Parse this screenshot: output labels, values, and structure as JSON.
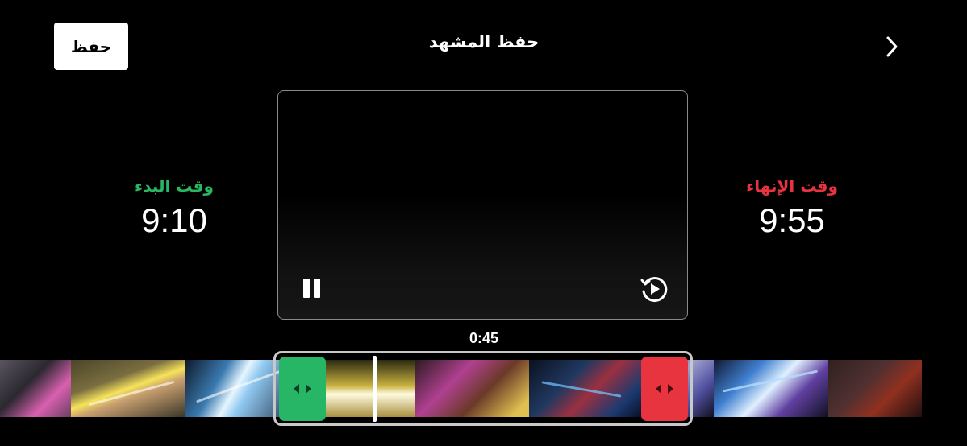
{
  "header": {
    "save_label": "حفظ",
    "title": "حفظ المشهد",
    "back_icon": "chevron-right-icon"
  },
  "trim": {
    "start_label": "وقت البدء",
    "start_time": "9:10",
    "end_label": "وقت الإنهاء",
    "end_time": "9:55",
    "duration": "0:45"
  },
  "player": {
    "pause_icon": "pause-icon",
    "replay_icon": "replay-icon",
    "state": "playing"
  },
  "colors": {
    "start_accent": "#27b566",
    "end_accent": "#e8343f",
    "background": "#000000"
  },
  "filmstrip": {
    "frame_count": 9,
    "icons": {
      "start_handle": "drag-arrows-icon",
      "end_handle": "drag-arrows-icon"
    }
  }
}
